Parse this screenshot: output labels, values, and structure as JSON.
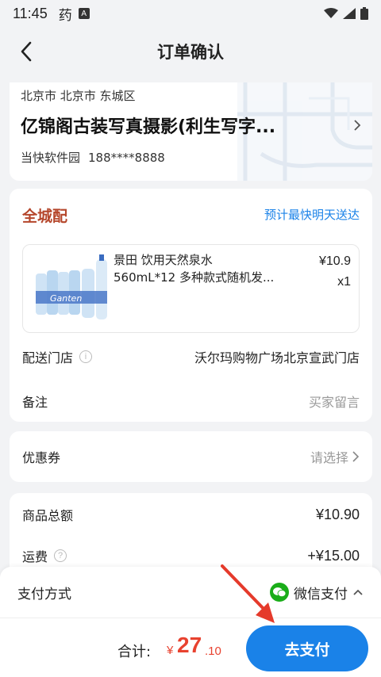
{
  "status_bar": {
    "time": "11:45",
    "app_glyph": "药",
    "badge": "A"
  },
  "nav": {
    "title": "订单确认"
  },
  "address": {
    "region": "北京市 北京市 东城区",
    "name": "亿锦阁古装写真摄影(利生写字...",
    "contact_name": "当快软件园",
    "phone": "188****8888"
  },
  "order": {
    "delivery_type": "全城配",
    "eta": "预计最快明天送达",
    "item": {
      "name_line1": "景田 饮用天然泉水",
      "name_line2": "560mL*12 多种款式随机发...",
      "price": "¥10.9",
      "qty": "x1",
      "image_label": "Ganten"
    },
    "store_label": "配送门店",
    "store_value": "沃尔玛购物广场北京宣武门店",
    "remark_label": "备注",
    "remark_placeholder": "买家留言"
  },
  "coupon": {
    "label": "优惠券",
    "value": "请选择"
  },
  "summary": {
    "goods_total_label": "商品总额",
    "goods_total_value": "¥10.90",
    "shipping_label": "运费",
    "shipping_value": "+¥15.00"
  },
  "payment": {
    "label": "支付方式",
    "method": "微信支付"
  },
  "footer": {
    "total_label": "合计:",
    "currency": "¥",
    "total_int": "27",
    "total_dec": ".10",
    "pay_button": "去支付"
  },
  "colors": {
    "accent": "#1a82e8",
    "price_red": "#e8422f",
    "delivery_brown": "#b5462b",
    "wechat_green": "#1aad19"
  }
}
